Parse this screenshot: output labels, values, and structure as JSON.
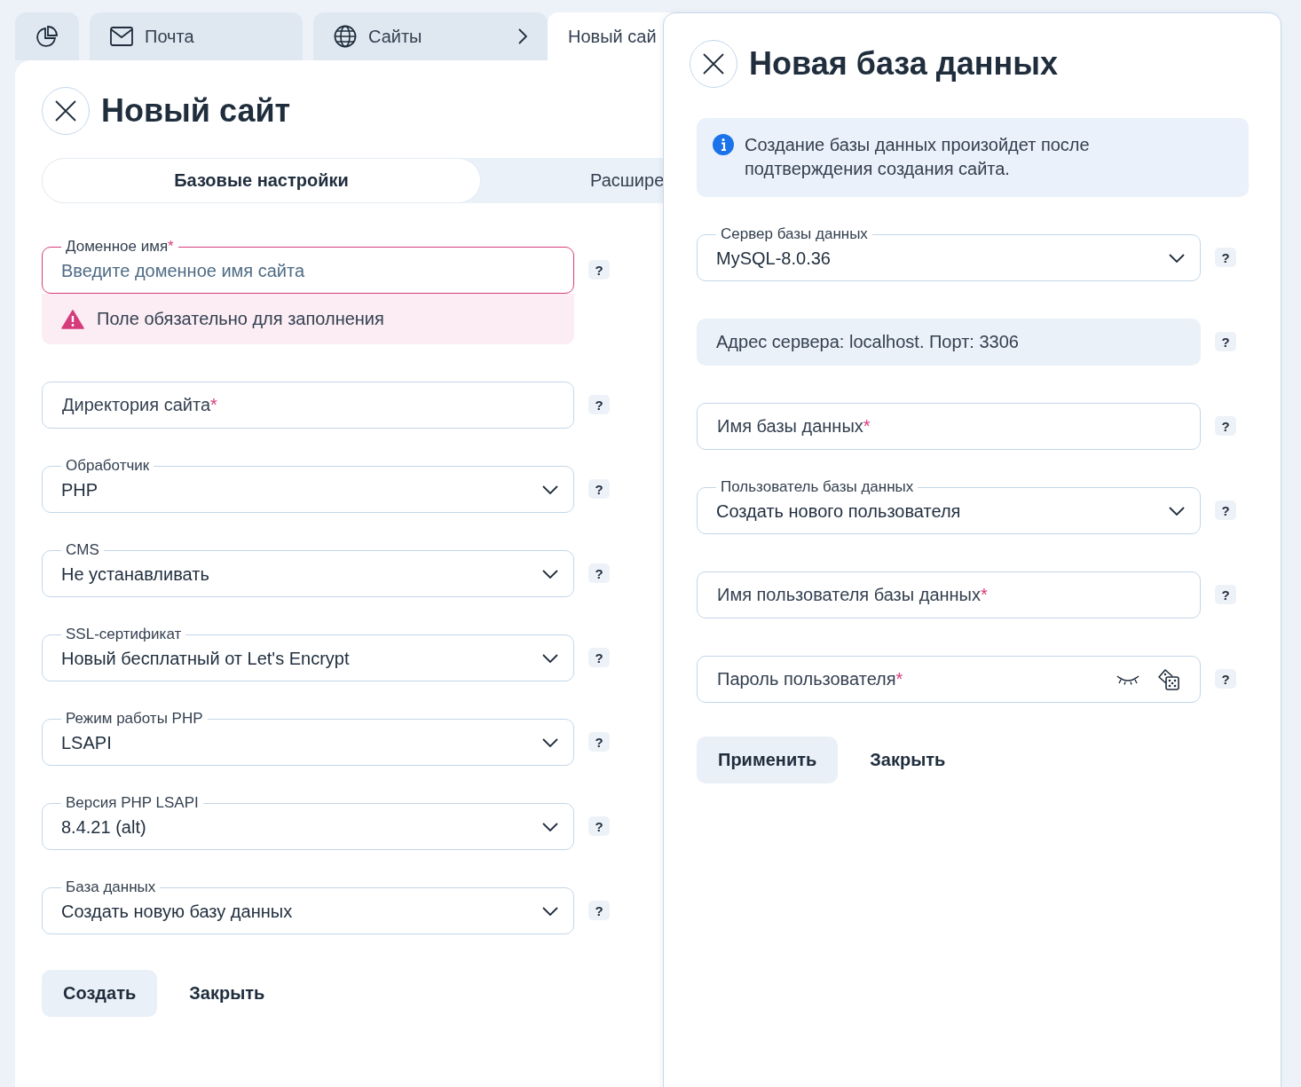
{
  "tabs": [
    {
      "kind": "dashboard",
      "selected": false
    },
    {
      "kind": "mail",
      "label": "Почта",
      "selected": false
    },
    {
      "kind": "sites",
      "label": "Сайты",
      "selected": false
    },
    {
      "kind": "page",
      "label": "Новый сай",
      "selected": true
    }
  ],
  "site_form": {
    "title": "Новый сайт",
    "modes": [
      {
        "label": "Базовые настройки",
        "selected": true
      },
      {
        "label": "Расшире",
        "selected": false
      }
    ],
    "fields": [
      {
        "kind": "input",
        "label": "Доменное имя",
        "mark": "*",
        "placeholder": "Введите доменное имя сайта",
        "invalid": true,
        "error": "Поле обязательно для заполнения",
        "help": "?"
      },
      {
        "kind": "input",
        "label": "Директория сайта",
        "mark": "*",
        "invalid": false,
        "help": "?"
      },
      {
        "kind": "select",
        "label": "Обработчик",
        "value": "PHP",
        "help": "?"
      },
      {
        "kind": "select",
        "label": "CMS",
        "value": "Не устанавливать",
        "help": "?"
      },
      {
        "kind": "select",
        "label": "SSL-сертификат",
        "value": "Новый бесплатный от Let's Encrypt",
        "help": "?"
      },
      {
        "kind": "select",
        "label": "Режим работы PHP",
        "value": "LSAPI",
        "help": "?"
      },
      {
        "kind": "select",
        "label": "Версия PHP LSAPI",
        "value": "8.4.21 (alt)",
        "help": "?"
      },
      {
        "kind": "select",
        "label": "База данных",
        "value": "Создать новую базу данных",
        "help": "?"
      }
    ],
    "buttons": [
      {
        "label": "Создать",
        "primary": true
      },
      {
        "label": "Закрыть",
        "primary": false
      }
    ]
  },
  "database_drawer": {
    "title": "Новая база данных",
    "info": "Создание базы данных произойдет после подтверждения создания сайта.",
    "fields": [
      {
        "kind": "select",
        "label": "Сервер базы данных",
        "value": "MySQL-8.0.36",
        "help": "?"
      },
      {
        "kind": "info",
        "value": "Адрес сервера: localhost. Порт: 3306",
        "help": "?"
      },
      {
        "kind": "input",
        "label": "Имя базы данных",
        "mark": "*",
        "invalid": false,
        "help": "?"
      },
      {
        "kind": "select",
        "label": "Пользователь базы данных",
        "value": "Создать нового пользователя",
        "help": "?"
      },
      {
        "kind": "input",
        "label": "Имя пользователя базы данных",
        "mark": "*",
        "invalid": false,
        "help": "?"
      },
      {
        "kind": "password",
        "label": "Пароль пользователя",
        "mark": "*",
        "help": "?"
      }
    ],
    "buttons": [
      {
        "label": "Применить",
        "primary": true
      },
      {
        "label": "Закрыть",
        "primary": false
      }
    ]
  }
}
